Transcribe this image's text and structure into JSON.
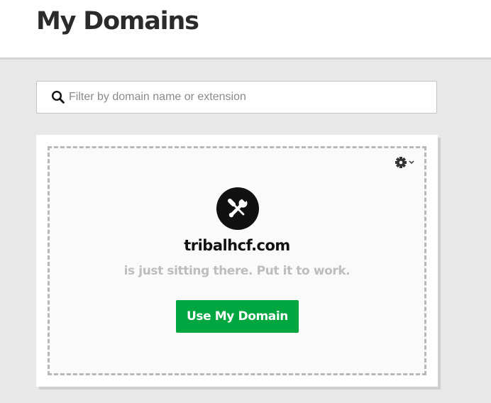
{
  "header": {
    "title": "My Domains"
  },
  "search": {
    "placeholder": "Filter by domain name or extension",
    "value": "",
    "icon": "search-icon"
  },
  "domain_card": {
    "settings_icon": "gear-icon",
    "dropdown_icon": "chevron-down-icon",
    "logo_icon": "wrench-screwdriver-icon",
    "domain_name": "tribalhcf.com",
    "tagline": "is just sitting there. Put it to work.",
    "button_label": "Use My Domain"
  },
  "colors": {
    "background": "#e8e8e8",
    "accent_green": "#00a63f",
    "title_text": "#2b2b2b",
    "muted_text": "#bdbdbd"
  }
}
